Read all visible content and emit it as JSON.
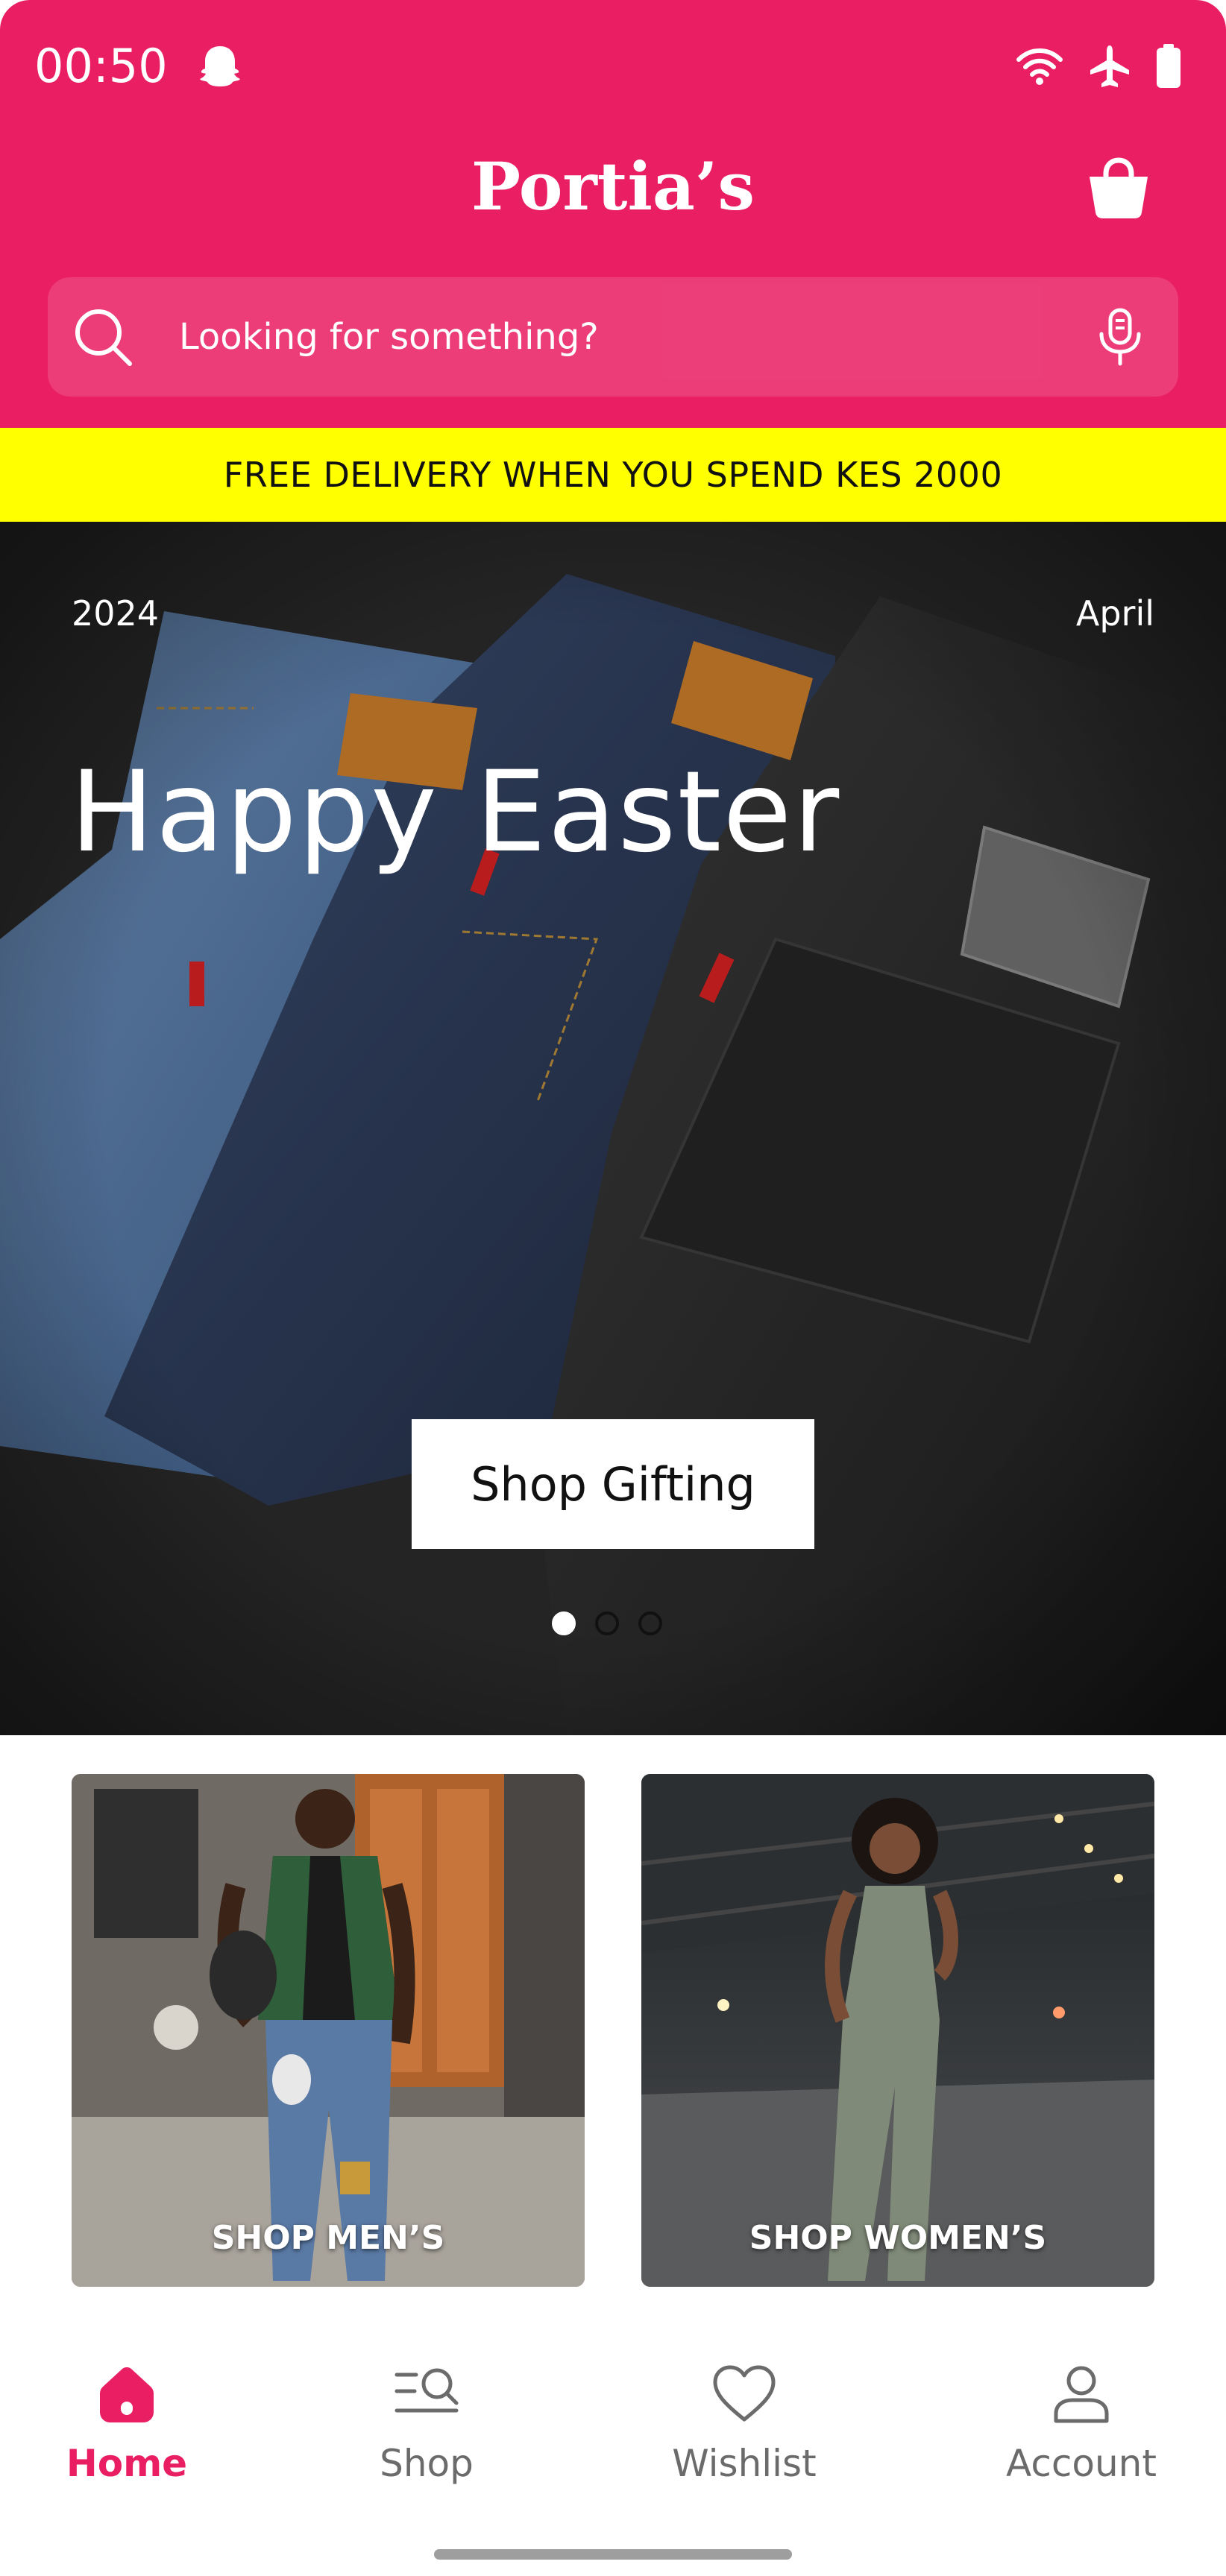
{
  "status_bar": {
    "time": "00:50",
    "icons": [
      "ghost-notification-icon",
      "wifi-icon",
      "airplane-mode-icon",
      "battery-icon"
    ]
  },
  "header": {
    "brand": "Portia’s",
    "cart_icon": "shopping-bag-icon"
  },
  "search": {
    "placeholder": "Looking for something?",
    "value": "",
    "search_icon": "search-icon",
    "voice_icon": "microphone-icon"
  },
  "promo": {
    "text": "FREE DELIVERY WHEN YOU SPEND KES 2000"
  },
  "hero": {
    "year": "2024",
    "month": "April",
    "title": "Happy Easter",
    "cta_label": "Shop Gifting",
    "slide_count": 3,
    "active_slide": 1
  },
  "categories": [
    {
      "label": "SHOP MEN’S"
    },
    {
      "label": "SHOP WOMEN’S"
    }
  ],
  "bottom_nav": {
    "items": [
      {
        "label": "Home",
        "icon": "home-icon",
        "active": true
      },
      {
        "label": "Shop",
        "icon": "shop-search-icon",
        "active": false
      },
      {
        "label": "Wishlist",
        "icon": "heart-icon",
        "active": false
      },
      {
        "label": "Account",
        "icon": "user-icon",
        "active": false
      }
    ]
  },
  "colors": {
    "brand": "#E91E63",
    "promo_bg": "#FFFF00",
    "nav_inactive": "#6B6B6B"
  }
}
